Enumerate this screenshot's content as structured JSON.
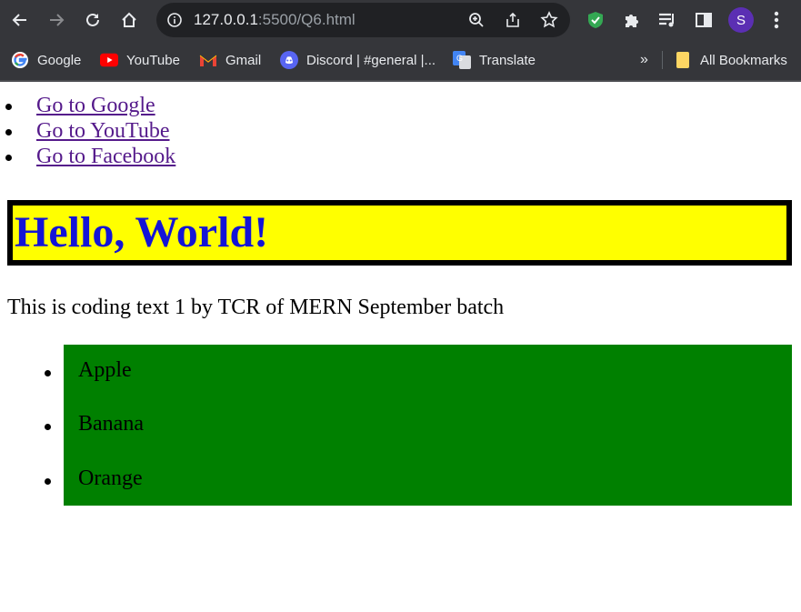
{
  "browser": {
    "address_host": "127.0.0.1",
    "address_path": ":5500/Q6.html",
    "profile_initial": "S",
    "bookmarks": [
      {
        "label": "Google",
        "icon": "google-icon"
      },
      {
        "label": "YouTube",
        "icon": "youtube-icon"
      },
      {
        "label": "Gmail",
        "icon": "gmail-icon"
      },
      {
        "label": "Discord | #general |...",
        "icon": "discord-icon"
      },
      {
        "label": "Translate",
        "icon": "translate-icon"
      }
    ],
    "overflow": "»",
    "all_bookmarks": "All Bookmarks"
  },
  "page": {
    "links": [
      "Go to Google",
      "Go to YouTube",
      "Go to Facebook"
    ],
    "heading": "Hello, World!",
    "paragraph": "This is coding text 1 by TCR of MERN September batch",
    "fruits": [
      "Apple",
      "Banana",
      "Orange"
    ]
  },
  "colors": {
    "heading_bg": "#ffff00",
    "heading_text": "#1414d6",
    "list_bg": "#008000",
    "link": "#551a8b"
  }
}
